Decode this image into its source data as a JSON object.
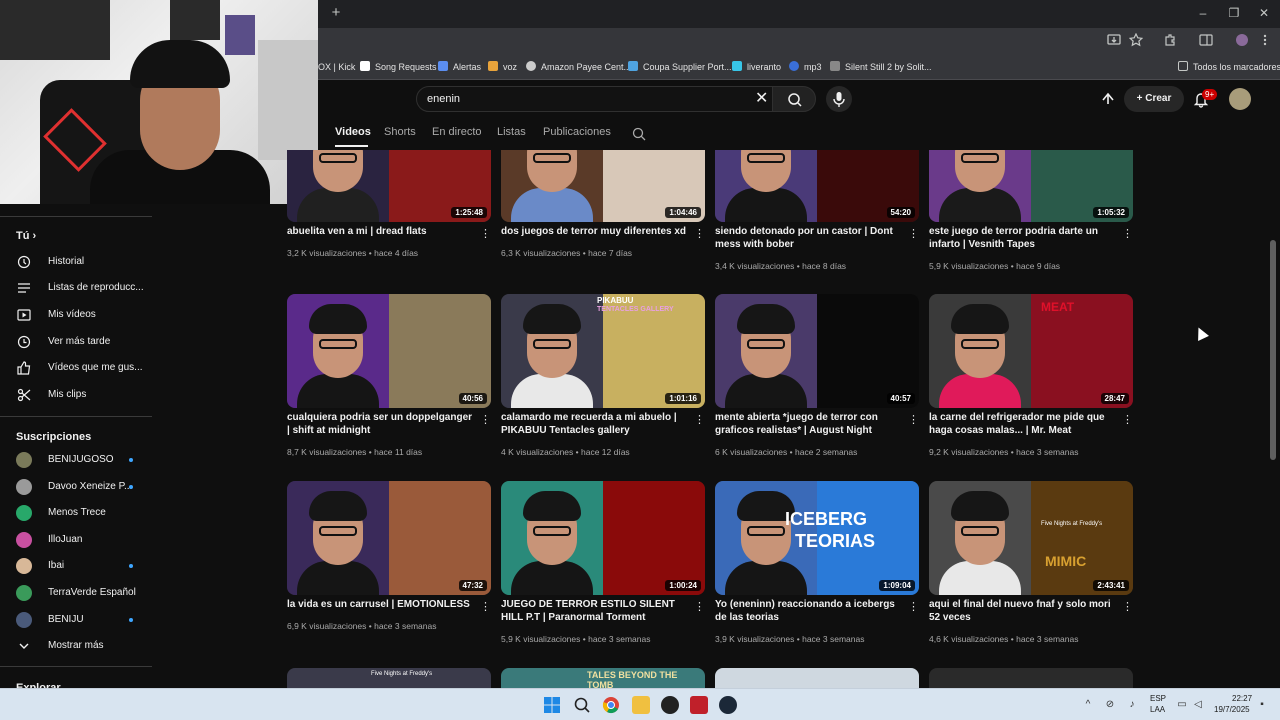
{
  "browser": {
    "bookmarks": [
      {
        "label": "OX | Kick",
        "color": "#53fc18"
      },
      {
        "label": "Song Requests",
        "color": "#ffffff"
      },
      {
        "label": "Alertas",
        "color": "#5b8def"
      },
      {
        "label": "voz",
        "color": "#e8a33b"
      },
      {
        "label": "Amazon Payee Cent...",
        "color": "#cccccc"
      },
      {
        "label": "Coupa Supplier Port...",
        "color": "#4fa3e0"
      },
      {
        "label": "liveranto",
        "color": "#38c6e8"
      },
      {
        "label": "mp3",
        "color": "#3a6fd8"
      },
      {
        "label": "Silent Still 2 by Solit...",
        "color": "#888888"
      }
    ],
    "all_bookmarks": "Todos los marcadores",
    "new_tab": "+",
    "minimize": "–",
    "restore": "❐",
    "close": "✕"
  },
  "header": {
    "search_value": "enenin",
    "clear": "✕",
    "create_label": "Crear",
    "notifications_badge": "9+"
  },
  "channel_tabs": [
    {
      "label": "Videos",
      "active": true
    },
    {
      "label": "Shorts",
      "active": false
    },
    {
      "label": "En directo",
      "active": false
    },
    {
      "label": "Listas",
      "active": false
    },
    {
      "label": "Publicaciones",
      "active": false
    }
  ],
  "sidebar": {
    "you_label": "Tú",
    "you_chevron": "›",
    "items": [
      {
        "label": "Historial",
        "icon": "history-icon"
      },
      {
        "label": "Listas de reproducc...",
        "icon": "playlist-icon"
      },
      {
        "label": "Mis vídeos",
        "icon": "my-videos-icon"
      },
      {
        "label": "Ver más tarde",
        "icon": "watch-later-icon"
      },
      {
        "label": "Vídeos que me gus...",
        "icon": "like-icon"
      },
      {
        "label": "Mis clips",
        "icon": "clips-icon"
      }
    ],
    "subscriptions_label": "Suscripciones",
    "subscriptions": [
      {
        "label": "BENIJUGOSO",
        "color": "#7a7a5a",
        "new": true
      },
      {
        "label": "Davoo Xeneize P...",
        "color": "#9a9a9a",
        "new": true
      },
      {
        "label": "Menos Trece",
        "color": "#28a86a",
        "new": false
      },
      {
        "label": "IlloJuan",
        "color": "#c850a0",
        "new": false
      },
      {
        "label": "Ibai",
        "color": "#d8b898",
        "new": true
      },
      {
        "label": "TerraVerde Español",
        "color": "#3a9a5a",
        "new": false
      },
      {
        "label": "BENIJU",
        "color": "#4a5a7a",
        "new": true
      }
    ],
    "show_more": "Mostrar más",
    "explore_label": "Explorar"
  },
  "videos": [
    {
      "title": "abuelita ven a mi | dread flats",
      "views": "3,2 K visualizaciones",
      "age": "hace 4 días",
      "duration": "1:25:48",
      "bg_left": "#2a2340",
      "bg_right": "#8a1a1a",
      "shirt": "#202020"
    },
    {
      "title": "dos juegos de terror muy diferentes xd",
      "views": "6,3 K visualizaciones",
      "age": "hace 7 días",
      "duration": "1:04:46",
      "bg_left": "#5a3a28",
      "bg_right": "#d8c8b8",
      "shirt": "#6a8ac8"
    },
    {
      "title": "siendo detonado por un castor | Dont mess with bober",
      "views": "3,4 K visualizaciones",
      "age": "hace 8 días",
      "duration": "54:20",
      "bg_left": "#4a3a78",
      "bg_right": "#3a0a0a",
      "shirt": "#151515"
    },
    {
      "title": "este juego de terror podria darte un infarto | Vesnith Tapes",
      "views": "5,9 K visualizaciones",
      "age": "hace 9 días",
      "duration": "1:05:32",
      "bg_left": "#6a3a8a",
      "bg_right": "#2a5a4a",
      "shirt": "#1a1a1a"
    },
    {
      "title": "cualquiera podria ser un doppelganger | shift at midnight",
      "views": "8,7 K visualizaciones",
      "age": "hace 11 días",
      "duration": "40:56",
      "bg_left": "#5a2a8a",
      "bg_right": "#8a7a5a",
      "shirt": "#151515"
    },
    {
      "title": "calamardo me recuerda a mi abuelo | PIKABUU Tentacles gallery",
      "views": "4 K visualizaciones",
      "age": "hace 12 días",
      "duration": "1:01:16",
      "bg_left": "#3a3a4a",
      "bg_right": "#c8b060",
      "shirt": "#e8e8e8"
    },
    {
      "title": "mente abierta *juego de terror con graficos realistas* | August Night",
      "views": "6 K visualizaciones",
      "age": "hace 2 semanas",
      "duration": "40:57",
      "bg_left": "#4a3a6a",
      "bg_right": "#0a0a0a",
      "shirt": "#151515"
    },
    {
      "title": "la carne del refrigerador me pide que haga cosas malas... | Mr. Meat",
      "views": "9,2 K visualizaciones",
      "age": "hace 3 semanas",
      "duration": "28:47",
      "bg_left": "#3a3a3a",
      "bg_right": "#8a1020",
      "shirt": "#e01a5a"
    },
    {
      "title": "la vida es un carrusel | EMOTIONLESS",
      "views": "6,9 K visualizaciones",
      "age": "hace 3 semanas",
      "duration": "47:32",
      "bg_left": "#3a2a5a",
      "bg_right": "#9a5a3a",
      "shirt": "#151515"
    },
    {
      "title": "JUEGO DE TERROR ESTILO SILENT HILL P.T | Paranormal Torment",
      "views": "5,9 K visualizaciones",
      "age": "hace 3 semanas",
      "duration": "1:00:24",
      "bg_left": "#2a8a7a",
      "bg_right": "#8a0a0a",
      "shirt": "#151515"
    },
    {
      "title": "Yo (eneninn) reaccionando a icebergs de las teorias",
      "views": "3,9 K visualizaciones",
      "age": "hace 3 semanas",
      "duration": "1:09:04",
      "bg_left": "#3a6ab8",
      "bg_right": "#2a7ad8",
      "shirt": "#151515"
    },
    {
      "title": "aqui el final del nuevo fnaf y solo mori 52 veces",
      "views": "4,6 K visualizaciones",
      "age": "hace 3 semanas",
      "duration": "2:43:41",
      "bg_left": "#4a4a4a",
      "bg_right": "#5a3a10",
      "shirt": "#e8e8e8"
    }
  ],
  "thumb_overlays": {
    "pikabuu": "PIKABUU",
    "pikabuu_sub": "TENTACLES GALLERY",
    "meat": "MEAT",
    "iceberg": "ICEBERG",
    "teorias": "TEORIAS",
    "fnaf": "Five Nights at Freddy's",
    "mimic": "MIMIC",
    "tales": "TALES BEYOND THE TOMB",
    "fnaf2": "Five Nights at Freddy's"
  },
  "taskbar": {
    "lang": "ESP",
    "lang2": "LAA",
    "time": "22:27",
    "date": "19/7/2025"
  }
}
